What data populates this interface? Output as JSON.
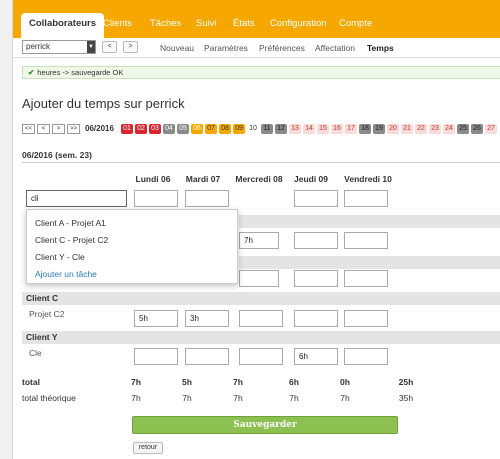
{
  "topnav": {
    "tabs": [
      {
        "label": "Collaborateurs",
        "active": true
      },
      {
        "label": "Clients"
      },
      {
        "label": "Tâches"
      },
      {
        "label": "Suivi"
      },
      {
        "label": "États"
      },
      {
        "label": "Configuration"
      },
      {
        "label": "Compte"
      }
    ]
  },
  "subnav": {
    "user_select": "perrick",
    "prev": "<",
    "next": ">",
    "tabs": [
      {
        "label": "Nouveau"
      },
      {
        "label": "Paramètres"
      },
      {
        "label": "Préférences"
      },
      {
        "label": "Affectation"
      },
      {
        "label": "Temps",
        "active": true
      }
    ]
  },
  "flash": {
    "message": "heures -> sauvegarde OK"
  },
  "page_title": "Ajouter du temps sur perrick",
  "calendar": {
    "nav": [
      "<<",
      "<",
      ">",
      ">>"
    ],
    "month": "06/2016",
    "days": [
      "01",
      "02",
      "03",
      "04",
      "05",
      "06",
      "07",
      "08",
      "09",
      "10",
      "11",
      "12",
      "13",
      "14",
      "15",
      "16",
      "17",
      "18",
      "19",
      "20",
      "21",
      "22",
      "23",
      "24",
      "25",
      "26",
      "27"
    ],
    "colors": {
      "red": "#d9262c",
      "gray": "#8a8a8a",
      "orange": "#f6a800",
      "pink": "#fbdada",
      "text_pink": "#c0392b"
    }
  },
  "week": {
    "heading": "06/2016 (sem. 23)",
    "columns": [
      "Lundi 06",
      "Mardi 07",
      "Mercredi 08",
      "Jeudi 09",
      "Vendredi 10"
    ]
  },
  "search": {
    "value": "cli"
  },
  "dropdown": {
    "items": [
      "Client A - Projet A1",
      "Client C - Projet C2",
      "Client Y - Cle"
    ],
    "add_link": "Ajouter un tâche"
  },
  "rows": {
    "hidden_row_value": "7h",
    "client_c": {
      "client": "Client C",
      "project": "Projet C2",
      "values": [
        "5h",
        "3h",
        "",
        "",
        ""
      ]
    },
    "client_y": {
      "client": "Client Y",
      "project": "Cle",
      "values": [
        "",
        "",
        "",
        "6h",
        ""
      ]
    }
  },
  "totals": {
    "total_label": "total",
    "total_values": [
      "7h",
      "5h",
      "7h",
      "6h",
      "0h",
      "25h"
    ],
    "theorique_label": "total théorique",
    "theorique_values": [
      "7h",
      "7h",
      "7h",
      "7h",
      "7h",
      "35h"
    ]
  },
  "buttons": {
    "save": "Sauvegarder",
    "back": "retour"
  }
}
